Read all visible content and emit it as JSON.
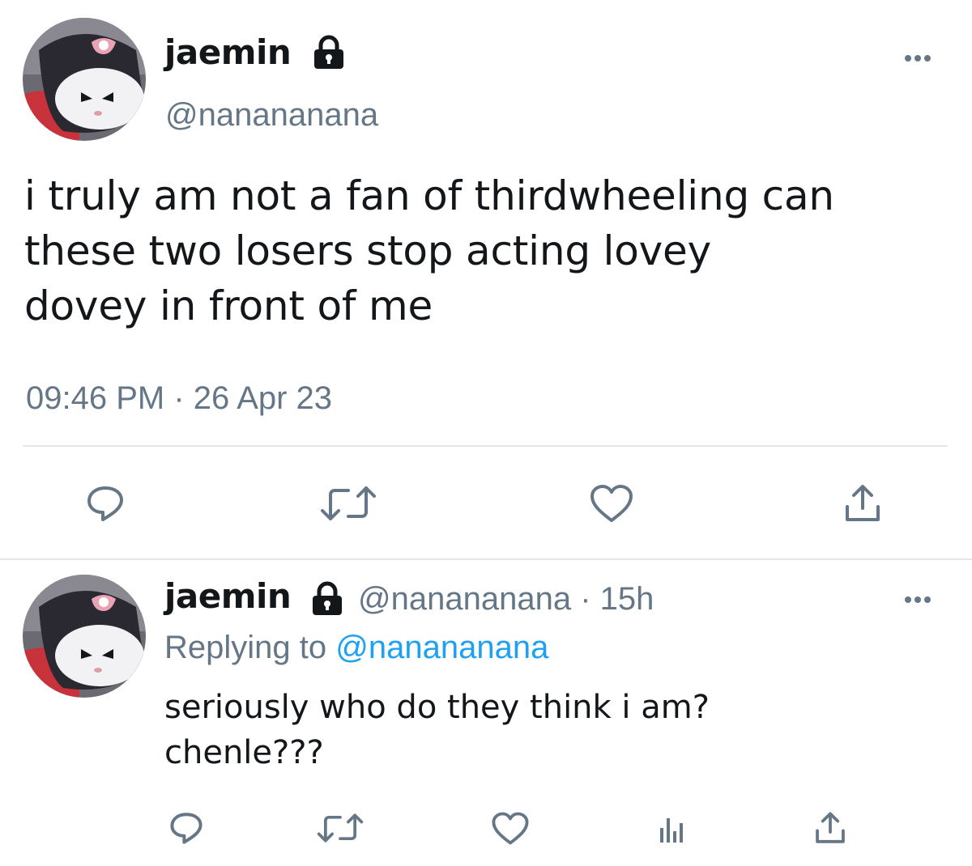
{
  "main_tweet": {
    "display_name": "jaemin",
    "handle": "@nanananana",
    "text": "i truly am not a fan of thirdwheeling can\nthese two losers stop acting lovey\ndovey in front of me",
    "time": "09:46 PM",
    "separator": "·",
    "date": "26 Apr 23",
    "more_icon": "more-horizontal-icon",
    "actions": [
      {
        "icon": "reply-icon"
      },
      {
        "icon": "retweet-icon"
      },
      {
        "icon": "like-icon"
      },
      {
        "icon": "share-icon"
      }
    ]
  },
  "reply_tweet": {
    "display_name": "jaemin",
    "handle": "@nanananana",
    "separator": "·",
    "age": "15h",
    "replying_prefix": "Replying to",
    "replying_to": "@nanananana",
    "text": "seriously who do they think i am?\nchenle???",
    "more_icon": "more-horizontal-icon",
    "actions": [
      {
        "icon": "reply-icon"
      },
      {
        "icon": "retweet-icon"
      },
      {
        "icon": "like-icon"
      },
      {
        "icon": "analytics-icon"
      },
      {
        "icon": "share-icon"
      }
    ]
  },
  "colors": {
    "text": "#14171a",
    "secondary": "#657786",
    "link": "#1da1f2",
    "divider": "#e1e8ed"
  }
}
